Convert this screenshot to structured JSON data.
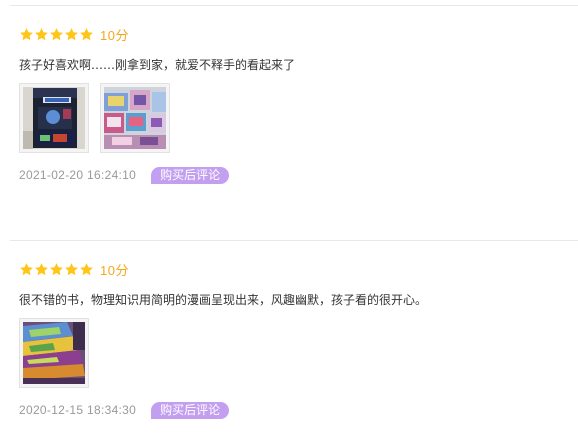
{
  "colors": {
    "star": "#ffc619",
    "score": "#f3a81b",
    "badge_bg": "#c39ff0",
    "timestamp": "#999999",
    "divider": "#e8e8e8"
  },
  "reviews": [
    {
      "stars": 5,
      "score": "10分",
      "text": "孩子好喜欢啊……刚拿到家，就爱不释手的看起来了",
      "images": [
        "book-cover-photo",
        "book-pages-photo"
      ],
      "timestamp": "2021-02-20 16:24:10",
      "badge": "购买后评论"
    },
    {
      "stars": 5,
      "score": "10分",
      "text": "很不错的书，物理知识用简明的漫画呈现出来，风趣幽默，孩子看的很开心。",
      "images": [
        "book-stack-photo"
      ],
      "timestamp": "2020-12-15 18:34:30",
      "badge": "购买后评论"
    }
  ]
}
